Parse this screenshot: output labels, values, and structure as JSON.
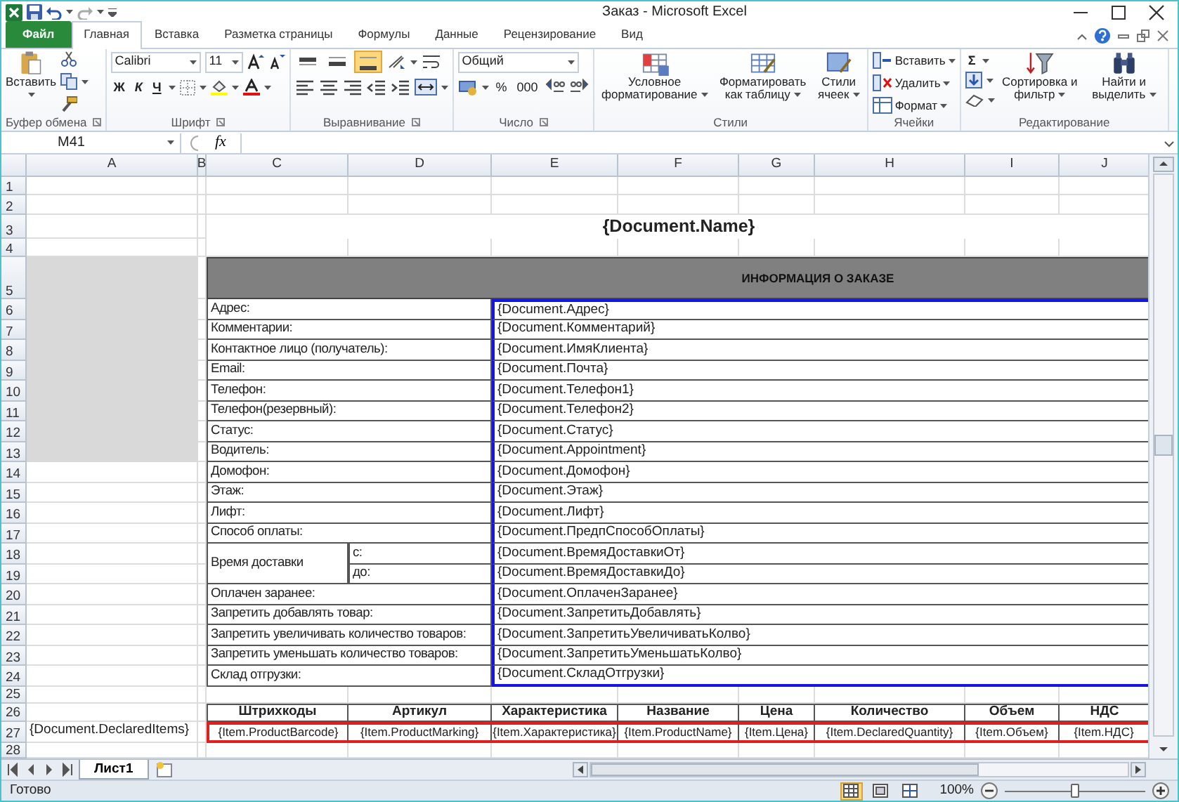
{
  "window": {
    "title": "Заказ - Microsoft Excel"
  },
  "tabs": [
    {
      "label": "Файл",
      "kind": "file",
      "selected": false
    },
    {
      "label": "Главная",
      "kind": "tab",
      "selected": true
    },
    {
      "label": "Вставка",
      "kind": "tab",
      "selected": false
    },
    {
      "label": "Разметка страницы",
      "kind": "tab",
      "selected": false
    },
    {
      "label": "Формулы",
      "kind": "tab",
      "selected": false
    },
    {
      "label": "Данные",
      "kind": "tab",
      "selected": false
    },
    {
      "label": "Рецензирование",
      "kind": "tab",
      "selected": false
    },
    {
      "label": "Вид",
      "kind": "tab",
      "selected": false
    }
  ],
  "ribbon": {
    "groups": [
      {
        "kind": "clipboard",
        "label": "Буфер обмена",
        "paste": "Вставить"
      },
      {
        "kind": "font",
        "label": "Шрифт",
        "font": "Calibri",
        "size": "11",
        "styles": [
          "Ж",
          "К",
          "Ч"
        ]
      },
      {
        "kind": "align",
        "label": "Выравнивание",
        "vertical": [
          {
            "kind": "top",
            "selected": false
          },
          {
            "kind": "middle",
            "selected": false
          },
          {
            "kind": "bottom",
            "selected": true
          }
        ]
      },
      {
        "kind": "number",
        "label": "Число",
        "format": "Общий",
        "symbols": [
          "%",
          "000"
        ]
      },
      {
        "kind": "styles",
        "label": "Стили",
        "buttons": [
          "Условное форматирование",
          "Форматировать как таблицу",
          "Стили ячеек"
        ]
      },
      {
        "kind": "cells",
        "label": "Ячейки",
        "buttons": [
          "Вставить",
          "Удалить",
          "Формат"
        ]
      },
      {
        "kind": "editing",
        "label": "Редактирование",
        "sum": "Σ",
        "buttons": [
          "Сортировка и фильтр",
          "Найти и выделить"
        ]
      }
    ]
  },
  "formula_bar": {
    "name_box": "M41",
    "fx": "fx"
  },
  "sheet": {
    "columns": [
      "A",
      "B",
      "C",
      "D",
      "E",
      "F",
      "G",
      "H",
      "I",
      "J"
    ],
    "rows": [
      "1",
      "2",
      "3",
      "4",
      "5",
      "6",
      "7",
      "8",
      "9",
      "10",
      "11",
      "12",
      "13",
      "14",
      "15",
      "16",
      "17",
      "18",
      "19",
      "20",
      "21",
      "22",
      "23",
      "24",
      "25",
      "26",
      "27",
      "28"
    ],
    "title": "{Document.Name}",
    "section_header": "ИНФОРМАЦИЯ О ЗАКАЗЕ",
    "info": [
      {
        "kind": "field",
        "label": "Адрес:",
        "value": "{Document.Адрес}"
      },
      {
        "kind": "field",
        "label": "Комментарии:",
        "value": "{Document.Комментарий}"
      },
      {
        "kind": "field",
        "label": "Контактное лицо (получатель):",
        "value": "{Document.ИмяКлиента}"
      },
      {
        "kind": "field",
        "label": "Email:",
        "value": "{Document.Почта}"
      },
      {
        "kind": "field",
        "label": "Телефон:",
        "value": "{Document.Телефон1}"
      },
      {
        "kind": "field",
        "label": "Телефон(резервный):",
        "value": "{Document.Телефон2}"
      },
      {
        "kind": "field",
        "label": "Статус:",
        "value": "{Document.Статус}"
      },
      {
        "kind": "field",
        "label": "Водитель:",
        "value": "{Document.Appointment}"
      },
      {
        "kind": "field",
        "label": "Домофон:",
        "value": "{Document.Домофон}"
      },
      {
        "kind": "field",
        "label": "Этаж:",
        "value": "{Document.Этаж}"
      },
      {
        "kind": "field",
        "label": "Лифт:",
        "value": "{Document.Лифт}"
      },
      {
        "kind": "field",
        "label": "Способ оплаты:",
        "value": "{Document.ПредпСпособОплаты}"
      },
      {
        "kind": "split",
        "label": "Время доставки",
        "parts": [
          {
            "label": "с:",
            "value": "{Document.ВремяДоставкиОт}"
          },
          {
            "label": "до:",
            "value": "{Document.ВремяДоставкиДо}"
          }
        ]
      },
      {
        "kind": "field",
        "label": "Оплачен заранее:",
        "value": "{Document.ОплаченЗаранее}"
      },
      {
        "kind": "field",
        "label": "Запретить добавлять товар:",
        "value": "{Document.ЗапретитьДобавлять}"
      },
      {
        "kind": "field",
        "label": "Запретить увеличивать количество товаров:",
        "value": "{Document.ЗапретитьУвеличиватьКолво}"
      },
      {
        "kind": "field",
        "label": "Запретить уменьшать количество товаров:",
        "value": "{Document.ЗапретитьУменьшатьКолво}"
      },
      {
        "kind": "field",
        "label": "Склад отгрузки:",
        "value": "{Document.СкладОтгрузки}"
      }
    ],
    "list_name": "{Document.DeclaredItems}",
    "items": {
      "headers": [
        "Штрихкоды",
        "Артикул",
        "Характеристика",
        "Название",
        "Цена",
        "Количество",
        "Объем",
        "НДС"
      ],
      "cells": [
        "{Item.ProductBarcode}",
        "{Item.ProductMarking}",
        "{Item.Характеристика}",
        "{Item.ProductName}",
        "{Item.Цена}",
        "{Item.DeclaredQuantity}",
        "{Item.Объем}",
        "{Item.НДС}"
      ]
    }
  },
  "sheet_tabs": [
    {
      "label": "Лист1",
      "selected": true
    }
  ],
  "status_bar": {
    "text": "Готово",
    "views": [
      {
        "kind": "normal",
        "selected": true
      },
      {
        "kind": "layout",
        "selected": false
      },
      {
        "kind": "pagebreak",
        "selected": false
      }
    ],
    "zoom": {
      "reading": "100%",
      "level": 0.5
    }
  }
}
